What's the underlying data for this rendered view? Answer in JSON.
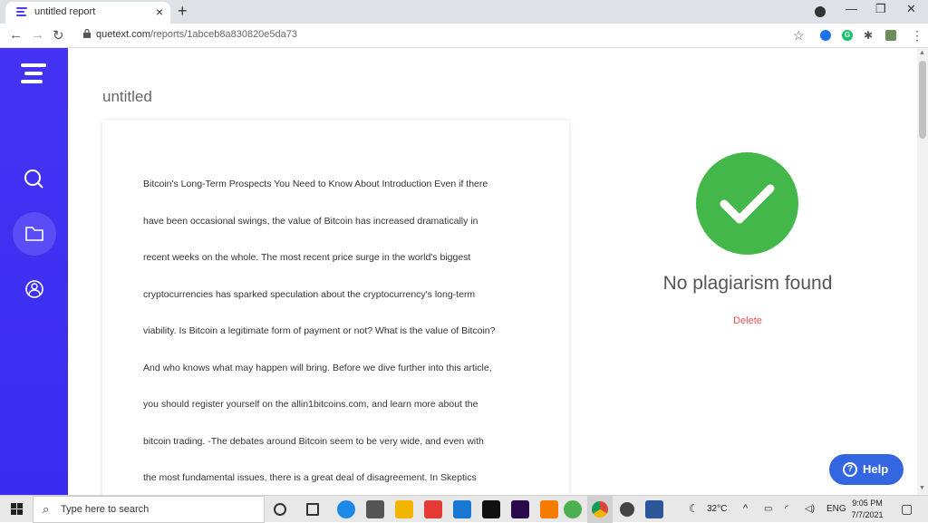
{
  "browser": {
    "tab_title": "untitled report",
    "tab_close": "×",
    "new_tab": "+",
    "url_host": "quetext.com",
    "url_path": "/reports/1abceb8a830820e5da73",
    "back": "←",
    "forward": "→",
    "reload": "↻",
    "star": "☆",
    "menu": "⋮",
    "minimize": "—",
    "restore": "❐",
    "close": "✕",
    "ext_g": "G",
    "puzzle": "✱"
  },
  "sidebar": {
    "items": [
      {
        "icon": "search-icon"
      },
      {
        "icon": "folder-icon",
        "active": true
      },
      {
        "icon": "user-icon"
      }
    ]
  },
  "report": {
    "title": "untitled",
    "lines": [
      "Bitcoin's Long-Term Prospects You Need to Know About Introduction Even if there",
      "have been occasional swings, the value of Bitcoin has increased dramatically in",
      "recent weeks on the whole. The most recent price surge in the world's biggest",
      "cryptocurrencies has sparked speculation about the cryptocurrency's long-term",
      "viability. Is Bitcoin a legitimate form of payment or not? What is the value of Bitcoin?",
      "And who knows what may happen will bring. Before we dive further into this article,",
      "you should register yourself on the allin1bitcoins.com, and learn more about the",
      "bitcoin trading. -The debates around Bitcoin seem to be very wide, and even with",
      "the most fundamental issues, there is a great deal of disagreement. In Skeptics"
    ],
    "result_text": "No plagiarism found",
    "delete_label": "Delete",
    "help_label": "Help",
    "help_q": "?"
  },
  "taskbar": {
    "search_placeholder": "Type here to search",
    "search_glyph": "⌕",
    "weather": "32°C",
    "lang": "ENG",
    "time": "9:05 PM",
    "date": "7/7/2021",
    "chevron": "^",
    "notif": "▢"
  },
  "colors": {
    "sidebar": "#4433f2",
    "check": "#44b74a",
    "delete": "#e05252",
    "help": "#3366e0"
  }
}
